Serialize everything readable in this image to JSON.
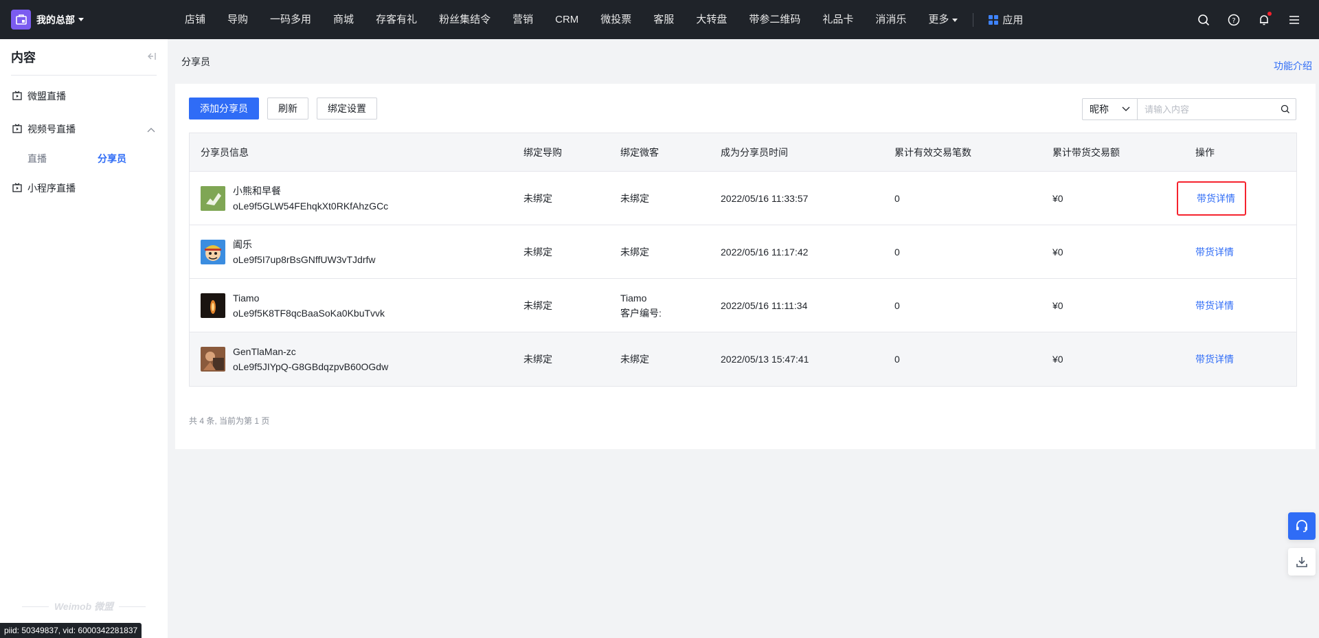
{
  "topnav": {
    "brand": "我的总部",
    "items": [
      "店铺",
      "导购",
      "一码多用",
      "商城",
      "存客有礼",
      "粉丝集结令",
      "营销",
      "CRM",
      "微投票",
      "客服",
      "大转盘",
      "带参二维码",
      "礼品卡",
      "消消乐"
    ],
    "more": "更多",
    "app": "应用"
  },
  "sidebar": {
    "title": "内容",
    "items": [
      {
        "label": "微盟直播"
      },
      {
        "label": "视频号直播"
      },
      {
        "label": "小程序直播"
      }
    ],
    "sub_items": [
      {
        "label": "直播"
      },
      {
        "label": "分享员"
      }
    ],
    "watermark": "Weimob 微盟",
    "id_badge": "piid: 50349837, vid: 6000342281837"
  },
  "breadcrumb": "分享员",
  "func_intro": "功能介绍",
  "toolbar": {
    "add": "添加分享员",
    "refresh": "刷新",
    "bind_settings": "绑定设置"
  },
  "search": {
    "field": "昵称",
    "placeholder": "请输入内容"
  },
  "table": {
    "headers": [
      "分享员信息",
      "绑定导购",
      "绑定微客",
      "成为分享员时间",
      "累计有效交易笔数",
      "累计带货交易额",
      "操作"
    ],
    "rows": [
      {
        "name": "小熊和早餐",
        "id": "oLe9f5GLW54FEhqkXt0RKfAhzGCc",
        "guide": "未绑定",
        "weike": "未绑定",
        "weike2": "",
        "time": "2022/05/16 11:33:57",
        "count": "0",
        "amount": "¥0",
        "action": "带货详情"
      },
      {
        "name": "阖乐",
        "id": "oLe9f5I7up8rBsGNffUW3vTJdrfw",
        "guide": "未绑定",
        "weike": "未绑定",
        "weike2": "",
        "time": "2022/05/16 11:17:42",
        "count": "0",
        "amount": "¥0",
        "action": "带货详情"
      },
      {
        "name": "Tiamo",
        "id": "oLe9f5K8TF8qcBaaSoKa0KbuTvvk",
        "guide": "未绑定",
        "weike": "Tiamo",
        "weike2": "客户编号:",
        "time": "2022/05/16 11:11:34",
        "count": "0",
        "amount": "¥0",
        "action": "带货详情"
      },
      {
        "name": "GenTlaMan-zc",
        "id": "oLe9f5JIYpQ-G8GBdqzpvB60OGdw",
        "guide": "未绑定",
        "weike": "未绑定",
        "weike2": "",
        "time": "2022/05/13 15:47:41",
        "count": "0",
        "amount": "¥0",
        "action": "带货详情"
      }
    ]
  },
  "pager": "共 4 条, 当前为第 1 页",
  "colors": {
    "accent": "#2f6cf6",
    "nav_bg": "#1f2329",
    "highlight": "#f5222d"
  }
}
